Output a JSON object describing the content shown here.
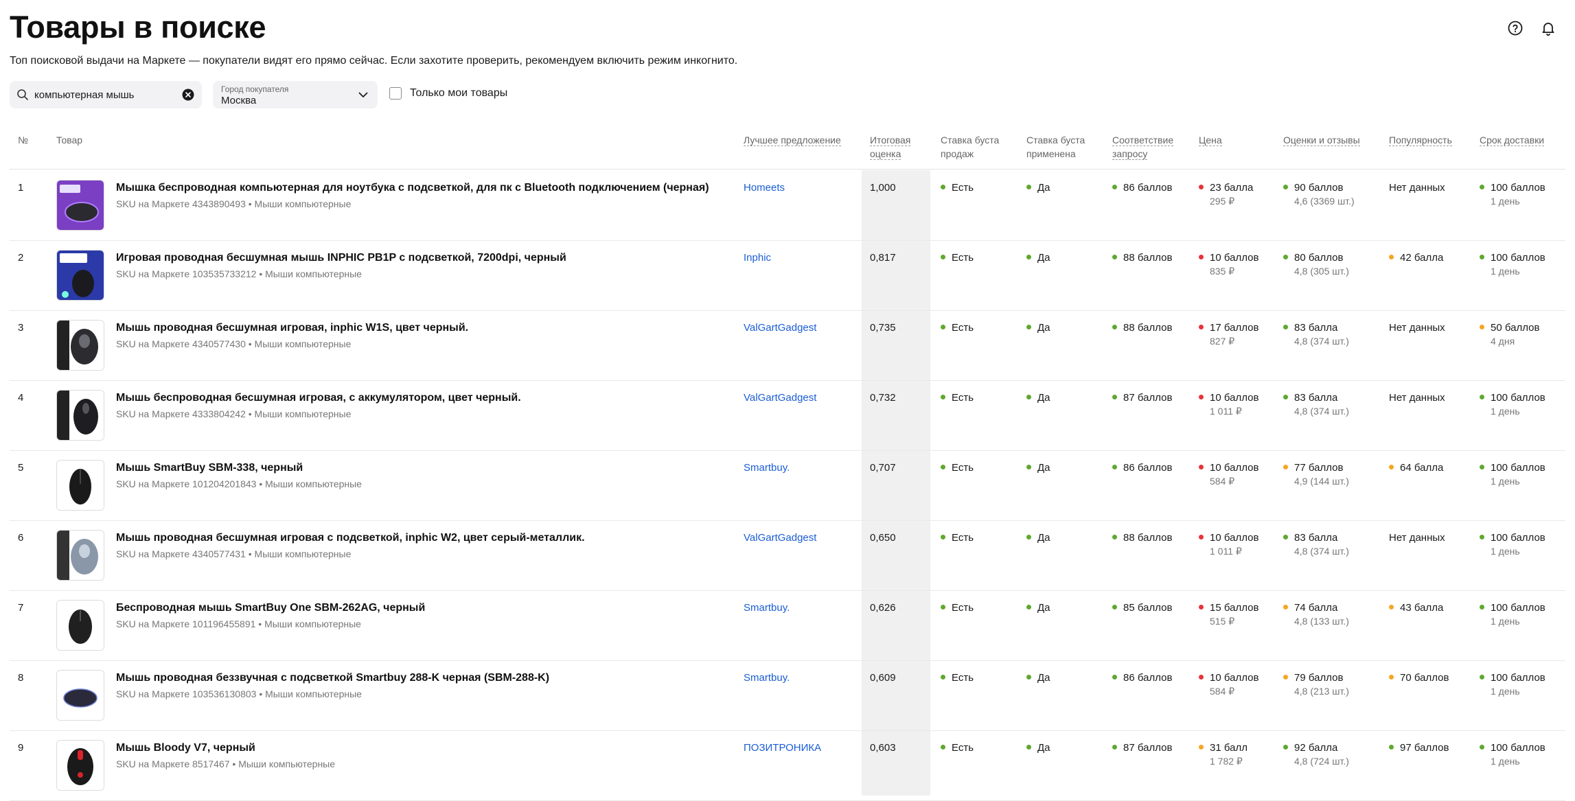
{
  "header": {
    "title": "Товары в поиске",
    "subtitle": "Топ поисковой выдачи на Маркете — покупатели видят его прямо сейчас. Если захотите проверить, рекомендуем включить режим инкогнито."
  },
  "search": {
    "value": "компьютерная мышь"
  },
  "city": {
    "label": "Город покупателя",
    "value": "Москва"
  },
  "only_mine": {
    "label": "Только мои товары",
    "checked": false
  },
  "columns": {
    "num": "№",
    "product": "Товар",
    "best_offer": "Лучшее предложение",
    "total_score": [
      "Итоговая",
      "оценка"
    ],
    "boost_rate": [
      "Ставка буста",
      "продаж"
    ],
    "boost_applied": [
      "Ставка буста",
      "применена"
    ],
    "relevance": [
      "Соответствие",
      "запросу"
    ],
    "price": "Цена",
    "reviews": "Оценки и отзывы",
    "popularity": "Популярность",
    "delivery": "Срок доставки"
  },
  "colors": {
    "green": "#5fa82e",
    "red": "#e8323a",
    "orange": "#f5a623",
    "link": "#1a5dd6",
    "highlight": "#f0f0f0"
  },
  "rows": [
    {
      "num": "1",
      "name": "Мышка беспроводная компьютерная для ноутбука с подсветкой, для пк с Bluetooth подключением (черная)",
      "sku": "SKU на Маркете 4343890493 • Мыши компьютерные",
      "seller": "Homeets",
      "score": "1,000",
      "boost_rate": "Есть",
      "boost_applied": "Да",
      "relevance": "86 баллов",
      "price": {
        "points": "23 балла",
        "value": "295 ₽",
        "color": "red"
      },
      "reviews": {
        "points": "90 баллов",
        "detail": "4,6 (3369 шт.)",
        "color": "green"
      },
      "popularity": {
        "text": "Нет данных"
      },
      "delivery": {
        "points": "100 баллов",
        "days": "1 день",
        "color": "green"
      }
    },
    {
      "num": "2",
      "name": "Игровая проводная бесшумная мышь INPHIC PB1P с подсветкой, 7200dpi, черный",
      "sku": "SKU на Маркете 103535733212 • Мыши компьютерные",
      "seller": "Inphic",
      "score": "0,817",
      "boost_rate": "Есть",
      "boost_applied": "Да",
      "relevance": "88 баллов",
      "price": {
        "points": "10 баллов",
        "value": "835 ₽",
        "color": "red"
      },
      "reviews": {
        "points": "80 баллов",
        "detail": "4,8 (305 шт.)",
        "color": "green"
      },
      "popularity": {
        "text": "42 балла",
        "color": "orange"
      },
      "delivery": {
        "points": "100 баллов",
        "days": "1 день",
        "color": "green"
      }
    },
    {
      "num": "3",
      "name": "Мышь проводная бесшумная игровая, inphic W1S, цвет черный.",
      "sku": "SKU на Маркете 4340577430 • Мыши компьютерные",
      "seller": "ValGartGadgest",
      "score": "0,735",
      "boost_rate": "Есть",
      "boost_applied": "Да",
      "relevance": "88 баллов",
      "price": {
        "points": "17 баллов",
        "value": "827 ₽",
        "color": "red"
      },
      "reviews": {
        "points": "83 балла",
        "detail": "4,8 (374 шт.)",
        "color": "green"
      },
      "popularity": {
        "text": "Нет данных"
      },
      "delivery": {
        "points": "50 баллов",
        "days": "4 дня",
        "color": "orange"
      }
    },
    {
      "num": "4",
      "name": "Мышь беспроводная бесшумная игровая, с аккумулятором, цвет черный.",
      "sku": "SKU на Маркете 4333804242 • Мыши компьютерные",
      "seller": "ValGartGadgest",
      "score": "0,732",
      "boost_rate": "Есть",
      "boost_applied": "Да",
      "relevance": "87 баллов",
      "price": {
        "points": "10 баллов",
        "value": "1 011 ₽",
        "color": "red"
      },
      "reviews": {
        "points": "83 балла",
        "detail": "4,8 (374 шт.)",
        "color": "green"
      },
      "popularity": {
        "text": "Нет данных"
      },
      "delivery": {
        "points": "100 баллов",
        "days": "1 день",
        "color": "green"
      }
    },
    {
      "num": "5",
      "name": "Мышь SmartBuy SBM-338, черный",
      "sku": "SKU на Маркете 101204201843 • Мыши компьютерные",
      "seller": "Smartbuy.",
      "score": "0,707",
      "boost_rate": "Есть",
      "boost_applied": "Да",
      "relevance": "86 баллов",
      "price": {
        "points": "10 баллов",
        "value": "584 ₽",
        "color": "red"
      },
      "reviews": {
        "points": "77 баллов",
        "detail": "4,9 (144 шт.)",
        "color": "orange"
      },
      "popularity": {
        "text": "64 балла",
        "color": "orange"
      },
      "delivery": {
        "points": "100 баллов",
        "days": "1 день",
        "color": "green"
      }
    },
    {
      "num": "6",
      "name": "Мышь проводная бесшумная игровая с подсветкой, inphic W2, цвет серый-металлик.",
      "sku": "SKU на Маркете 4340577431 • Мыши компьютерные",
      "seller": "ValGartGadgest",
      "score": "0,650",
      "boost_rate": "Есть",
      "boost_applied": "Да",
      "relevance": "88 баллов",
      "price": {
        "points": "10 баллов",
        "value": "1 011 ₽",
        "color": "red"
      },
      "reviews": {
        "points": "83 балла",
        "detail": "4,8 (374 шт.)",
        "color": "green"
      },
      "popularity": {
        "text": "Нет данных"
      },
      "delivery": {
        "points": "100 баллов",
        "days": "1 день",
        "color": "green"
      }
    },
    {
      "num": "7",
      "name": "Беспроводная мышь SmartBuy One SBM-262AG, черный",
      "sku": "SKU на Маркете 101196455891 • Мыши компьютерные",
      "seller": "Smartbuy.",
      "score": "0,626",
      "boost_rate": "Есть",
      "boost_applied": "Да",
      "relevance": "85 баллов",
      "price": {
        "points": "15 баллов",
        "value": "515 ₽",
        "color": "red"
      },
      "reviews": {
        "points": "74 балла",
        "detail": "4,8 (133 шт.)",
        "color": "orange"
      },
      "popularity": {
        "text": "43 балла",
        "color": "orange"
      },
      "delivery": {
        "points": "100 баллов",
        "days": "1 день",
        "color": "green"
      }
    },
    {
      "num": "8",
      "name": "Мышь проводная беззвучная с подсветкой Smartbuy 288-K черная (SBM-288-K)",
      "sku": "SKU на Маркете 103536130803 • Мыши компьютерные",
      "seller": "Smartbuy.",
      "score": "0,609",
      "boost_rate": "Есть",
      "boost_applied": "Да",
      "relevance": "86 баллов",
      "price": {
        "points": "10 баллов",
        "value": "584 ₽",
        "color": "red"
      },
      "reviews": {
        "points": "79 баллов",
        "detail": "4,8 (213 шт.)",
        "color": "orange"
      },
      "popularity": {
        "text": "70 баллов",
        "color": "orange"
      },
      "delivery": {
        "points": "100 баллов",
        "days": "1 день",
        "color": "green"
      }
    },
    {
      "num": "9",
      "name": "Мышь Bloody V7, черный",
      "sku": "SKU на Маркете 8517467 • Мыши компьютерные",
      "seller": "ПОЗИТРОНИКА",
      "score": "0,603",
      "boost_rate": "Есть",
      "boost_applied": "Да",
      "relevance": "87 баллов",
      "price": {
        "points": "31 балл",
        "value": "1 782 ₽",
        "color": "orange"
      },
      "reviews": {
        "points": "92 балла",
        "detail": "4,8 (724 шт.)",
        "color": "green"
      },
      "popularity": {
        "text": "97 баллов",
        "color": "green"
      },
      "delivery": {
        "points": "100 баллов",
        "days": "1 день",
        "color": "green"
      }
    }
  ]
}
